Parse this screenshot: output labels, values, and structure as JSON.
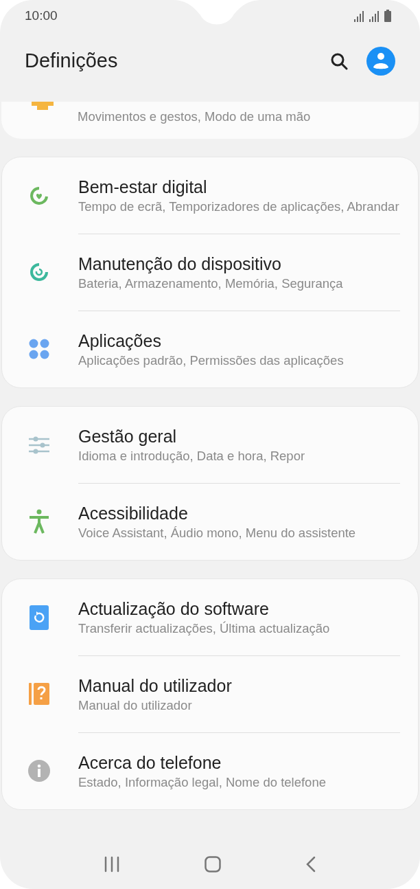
{
  "status_bar": {
    "time": "10:00"
  },
  "header": {
    "title": "Definições"
  },
  "partial_item": {
    "subtitle": "Movimentos e gestos, Modo de uma mão"
  },
  "groups": [
    {
      "items": [
        {
          "kind": "wellbeing",
          "title": "Bem-estar digital",
          "subtitle": "Tempo de ecrã, Temporizadores de aplicações, Abrandar"
        },
        {
          "kind": "care",
          "title": "Manutenção do dispositivo",
          "subtitle": "Bateria, Armazenamento, Memória, Segurança"
        },
        {
          "kind": "apps",
          "title": "Aplicações",
          "subtitle": "Aplicações padrão, Permissões das aplicações"
        }
      ]
    },
    {
      "items": [
        {
          "kind": "general",
          "title": "Gestão geral",
          "subtitle": "Idioma e introdução, Data e hora, Repor"
        },
        {
          "kind": "accessibility",
          "title": "Acessibilidade",
          "subtitle": "Voice Assistant, Áudio mono, Menu do assistente"
        }
      ]
    },
    {
      "items": [
        {
          "kind": "update",
          "title": "Actualização do software",
          "subtitle": "Transferir actualizações, Última actualização"
        },
        {
          "kind": "manual",
          "title": "Manual do utilizador",
          "subtitle": "Manual do utilizador"
        },
        {
          "kind": "about",
          "title": "Acerca do telefone",
          "subtitle": "Estado, Informação legal, Nome do telefone"
        }
      ]
    }
  ]
}
